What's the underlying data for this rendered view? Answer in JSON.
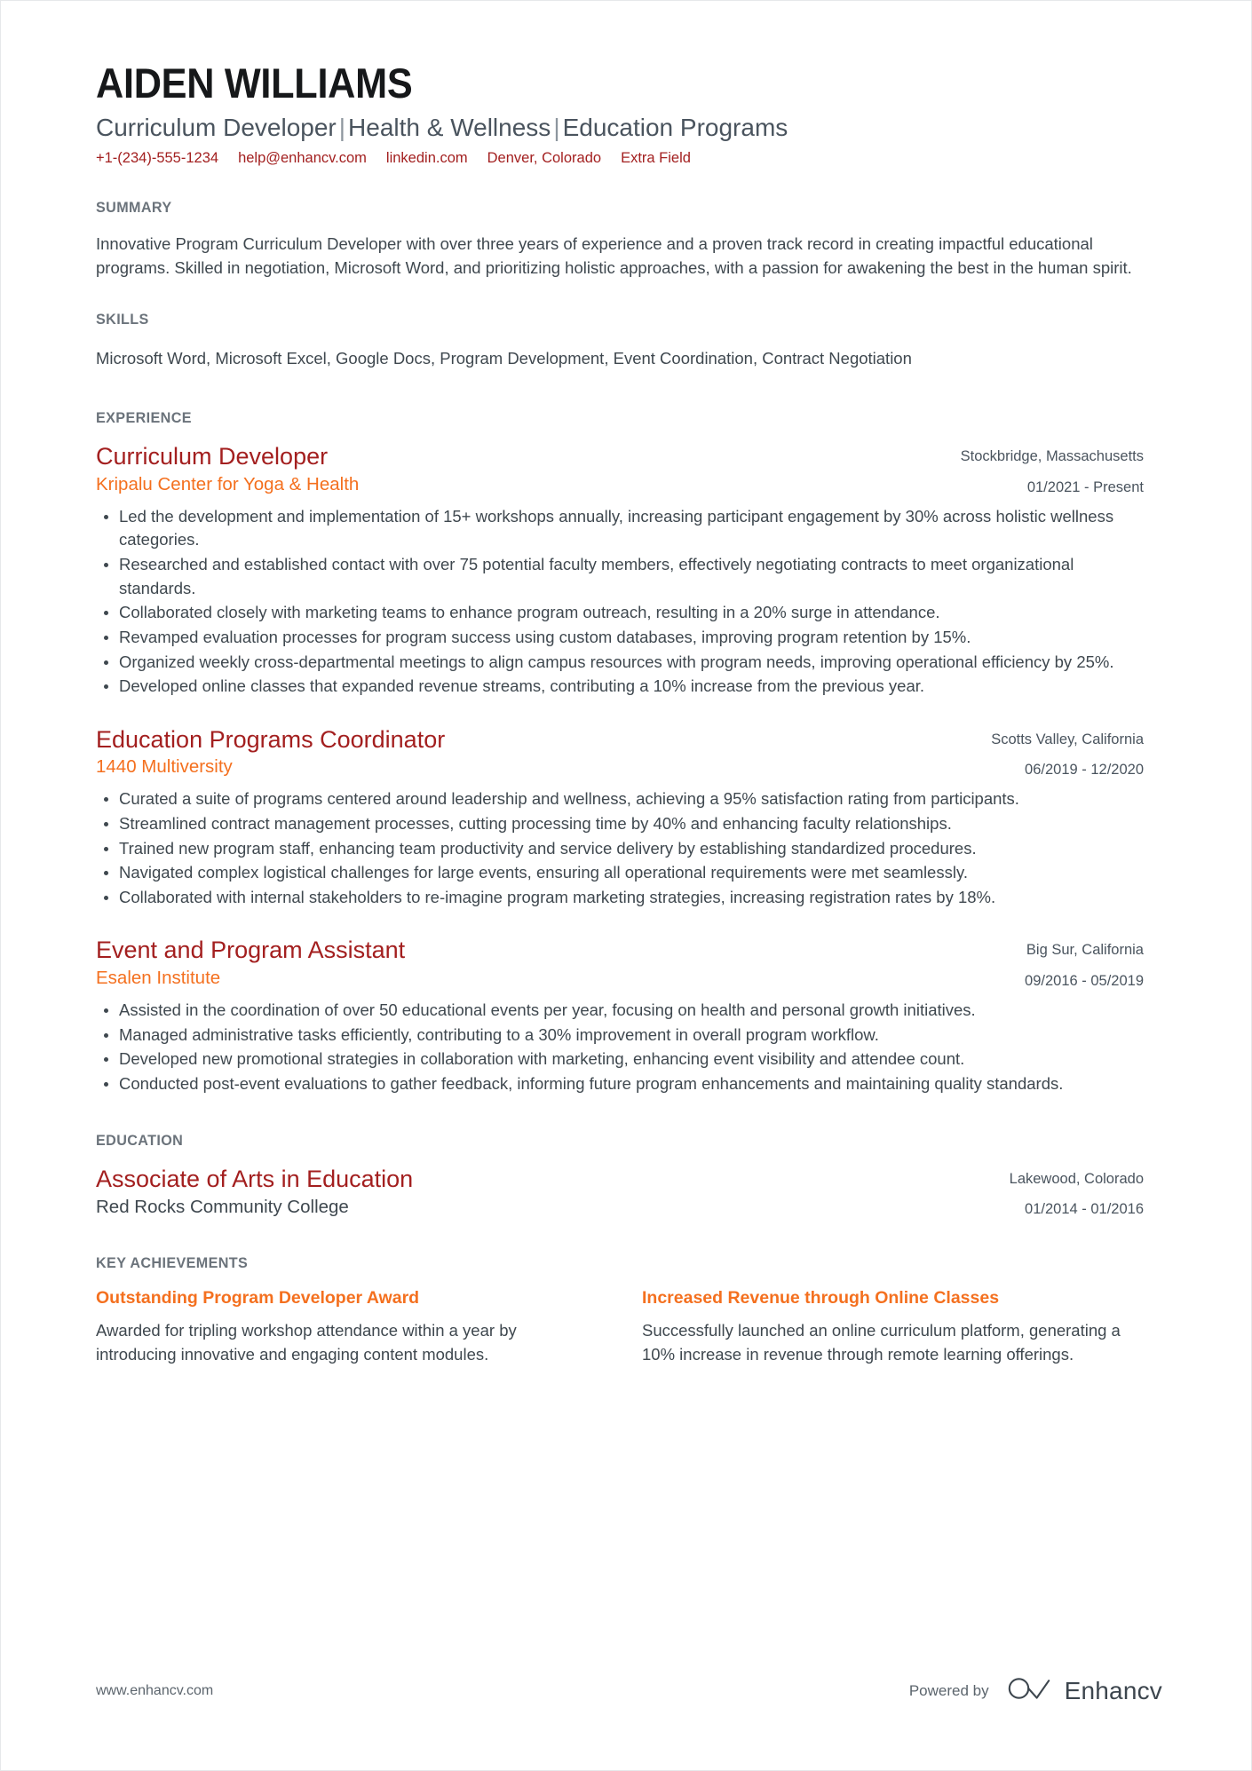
{
  "header": {
    "name": "AIDEN WILLIAMS",
    "headline_parts": [
      "Curriculum Developer",
      "Health & Wellness",
      "Education Programs"
    ],
    "headline_separator": "|",
    "contacts": [
      "+1-(234)-555-1234",
      "help@enhancv.com",
      "linkedin.com",
      "Denver, Colorado",
      "Extra Field"
    ]
  },
  "colors": {
    "accent_red": "#a31f1f",
    "accent_orange": "#f4701f",
    "contact_red": "#a32020",
    "heading_gray": "#6b737b",
    "body_gray": "#3f484f"
  },
  "summary": {
    "title": "SUMMARY",
    "text": "Innovative Program Curriculum Developer with over three years of experience and a proven track record in creating impactful educational programs. Skilled in negotiation, Microsoft Word, and prioritizing holistic approaches, with a passion for awakening the best in the human spirit."
  },
  "skills": {
    "title": "SKILLS",
    "text": "Microsoft Word, Microsoft Excel, Google Docs, Program Development, Event Coordination, Contract Negotiation"
  },
  "experience": {
    "title": "EXPERIENCE",
    "entries": [
      {
        "job_title": "Curriculum Developer",
        "organization": "Kripalu Center for Yoga & Health",
        "location": "Stockbridge, Massachusetts",
        "dates": "01/2021 - Present",
        "bullets": [
          "Led the development and implementation of 15+ workshops annually, increasing participant engagement by 30% across holistic wellness categories.",
          "Researched and established contact with over 75 potential faculty members, effectively negotiating contracts to meet organizational standards.",
          "Collaborated closely with marketing teams to enhance program outreach, resulting in a 20% surge in attendance.",
          "Revamped evaluation processes for program success using custom databases, improving program retention by 15%.",
          "Organized weekly cross-departmental meetings to align campus resources with program needs, improving operational efficiency by 25%.",
          "Developed online classes that expanded revenue streams, contributing a 10% increase from the previous year."
        ]
      },
      {
        "job_title": "Education Programs Coordinator",
        "organization": "1440 Multiversity",
        "location": "Scotts Valley, California",
        "dates": "06/2019 - 12/2020",
        "bullets": [
          "Curated a suite of programs centered around leadership and wellness, achieving a 95% satisfaction rating from participants.",
          "Streamlined contract management processes, cutting processing time by 40% and enhancing faculty relationships.",
          "Trained new program staff, enhancing team productivity and service delivery by establishing standardized procedures.",
          "Navigated complex logistical challenges for large events, ensuring all operational requirements were met seamlessly.",
          "Collaborated with internal stakeholders to re-imagine program marketing strategies, increasing registration rates by 18%."
        ]
      },
      {
        "job_title": "Event and Program Assistant",
        "organization": "Esalen Institute",
        "location": "Big Sur, California",
        "dates": "09/2016 - 05/2019",
        "bullets": [
          "Assisted in the coordination of over 50 educational events per year, focusing on health and personal growth initiatives.",
          "Managed administrative tasks efficiently, contributing to a 30% improvement in overall program workflow.",
          "Developed new promotional strategies in collaboration with marketing, enhancing event visibility and attendee count.",
          "Conducted post-event evaluations to gather feedback, informing future program enhancements and maintaining quality standards."
        ]
      }
    ]
  },
  "education": {
    "title": "EDUCATION",
    "entries": [
      {
        "degree": "Associate of Arts in Education",
        "school": "Red Rocks Community College",
        "location": "Lakewood, Colorado",
        "dates": "01/2014 - 01/2016"
      }
    ]
  },
  "achievements": {
    "title": "KEY ACHIEVEMENTS",
    "items": [
      {
        "title": "Outstanding Program Developer Award",
        "description": "Awarded for tripling workshop attendance within a year by introducing innovative and engaging content modules."
      },
      {
        "title": "Increased Revenue through Online Classes",
        "description": "Successfully launched an online curriculum platform, generating a 10% increase in revenue through remote learning offerings."
      }
    ]
  },
  "footer": {
    "url": "www.enhancv.com",
    "powered_by": "Powered by",
    "brand": "Enhancv"
  }
}
